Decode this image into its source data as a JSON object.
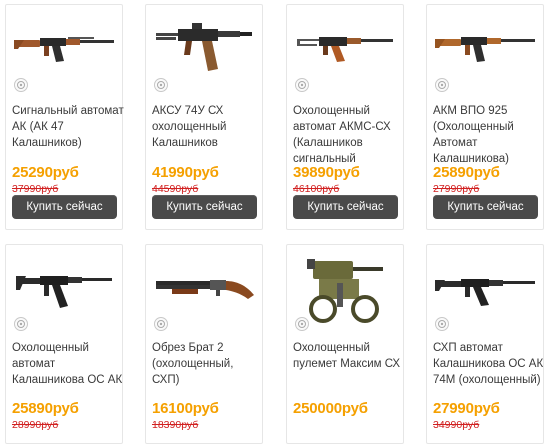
{
  "products": [
    {
      "title": "Сигнальный автомат АК (АК 47 Калашников)",
      "price": "25290руб",
      "old_price": "37990руб",
      "button": "Купить сейчас",
      "icon": "ak47-rifle-image"
    },
    {
      "title": "АКСУ 74У СХ охолощенный Калашников",
      "price": "41990руб",
      "old_price": "44590руб",
      "button": "Купить сейчас",
      "icon": "aks74u-rifle-image"
    },
    {
      "title": "Охолощенный автомат АКМС-СХ (Калашников сигнальный",
      "price": "39890руб",
      "old_price": "46100руб",
      "button": "Купить сейчас",
      "icon": "akms-rifle-image"
    },
    {
      "title": "АКМ ВПО 925 (Охолощенный Автомат Калашникова)",
      "price": "25890руб",
      "old_price": "27990руб",
      "button": "Купить сейчас",
      "icon": "akm-rifle-image"
    },
    {
      "title": "Охолощенный автомат Калашникова ОС АК 103 СХП (ИЖ",
      "price": "25890руб",
      "old_price": "28990руб",
      "icon": "ak103-rifle-image"
    },
    {
      "title": "Обрез Брат 2 (охолощенный, СХП)",
      "price": "16100руб",
      "old_price": "18390руб",
      "icon": "sawed-off-shotgun-image"
    },
    {
      "title": "Охолощенный пулемет Максим СХ",
      "price": "250000руб",
      "old_price": "",
      "icon": "maxim-machine-gun-image"
    },
    {
      "title": "СХП автомат Калашникова ОС АК 74М (охолощенный)",
      "price": "27990руб",
      "old_price": "34990руб",
      "icon": "ak74m-rifle-image"
    }
  ],
  "colors": {
    "price": "#f5a000",
    "old_price": "#d12020",
    "button_bg": "#4a4a4a",
    "button_text": "#ffffff"
  }
}
